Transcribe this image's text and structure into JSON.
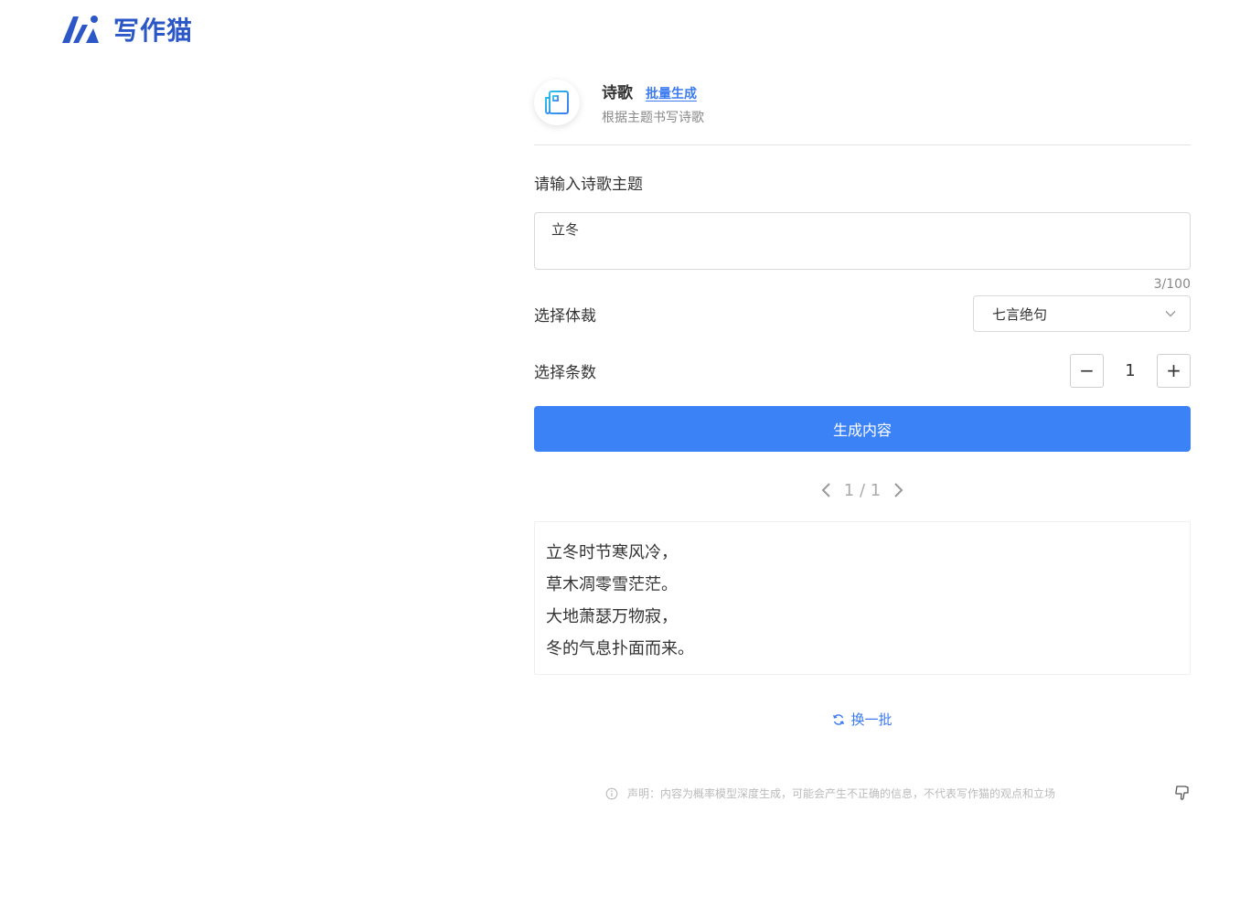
{
  "brand": {
    "name": "写作猫",
    "color": "#2b57c7"
  },
  "tool": {
    "icon": "newspaper-icon",
    "title": "诗歌",
    "batch_link": "批量生成",
    "description": "根据主题书写诗歌"
  },
  "form": {
    "topic_label": "请输入诗歌主题",
    "topic_value": "立冬",
    "char_count": "3/100",
    "genre_label": "选择体裁",
    "genre_value": "七言绝句",
    "count_label": "选择条数",
    "count_value": "1",
    "minus": "−",
    "plus": "+",
    "generate_label": "生成内容",
    "accent": "#3b82f6"
  },
  "pager": {
    "text": "1 / 1"
  },
  "result": {
    "lines": [
      "立冬时节寒风冷，",
      "草木凋零雪茫茫。",
      "大地萧瑟万物寂，",
      "冬的气息扑面而来。"
    ]
  },
  "refresh_label": "换一批",
  "disclaimer": "声明：内容为概率模型深度生成，可能会产生不正确的信息，不代表写作猫的观点和立场"
}
